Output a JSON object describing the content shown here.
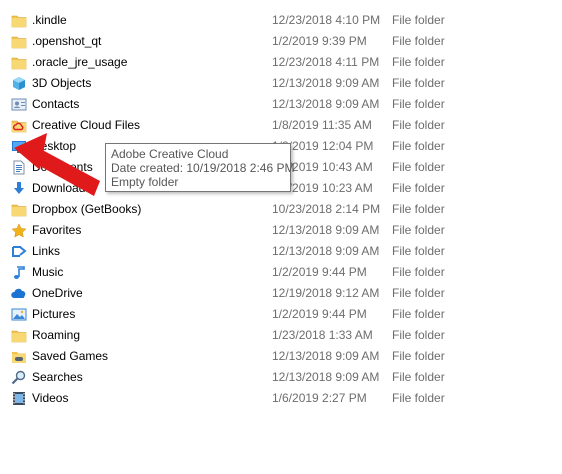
{
  "files": [
    {
      "name": ".kindle",
      "date": "12/23/2018 4:10 PM",
      "type": "File folder",
      "icon": "folder-icon"
    },
    {
      "name": ".openshot_qt",
      "date": "1/2/2019 9:39 PM",
      "type": "File folder",
      "icon": "folder-icon"
    },
    {
      "name": ".oracle_jre_usage",
      "date": "12/23/2018 4:11 PM",
      "type": "File folder",
      "icon": "folder-icon"
    },
    {
      "name": "3D Objects",
      "date": "12/13/2018 9:09 AM",
      "type": "File folder",
      "icon": "3d-objects-icon"
    },
    {
      "name": "Contacts",
      "date": "12/13/2018 9:09 AM",
      "type": "File folder",
      "icon": "contacts-icon"
    },
    {
      "name": "Creative Cloud Files",
      "date": "1/8/2019 11:35 AM",
      "type": "File folder",
      "icon": "creative-cloud-folder-icon"
    },
    {
      "name": "Desktop",
      "date": "1/8/2019 12:04 PM",
      "type": "File folder",
      "icon": "desktop-icon"
    },
    {
      "name": "Documents",
      "date": "1/2/2019 10:43 AM",
      "type": "File folder",
      "icon": "documents-icon"
    },
    {
      "name": "Downloads",
      "date": "1/2/2019 10:23 AM",
      "type": "File folder",
      "icon": "downloads-icon"
    },
    {
      "name": "Dropbox (GetBooks)",
      "date": "10/23/2018 2:14 PM",
      "type": "File folder",
      "icon": "folder-icon"
    },
    {
      "name": "Favorites",
      "date": "12/13/2018 9:09 AM",
      "type": "File folder",
      "icon": "favorites-icon"
    },
    {
      "name": "Links",
      "date": "12/13/2018 9:09 AM",
      "type": "File folder",
      "icon": "links-icon"
    },
    {
      "name": "Music",
      "date": "1/2/2019 9:44 PM",
      "type": "File folder",
      "icon": "music-icon"
    },
    {
      "name": "OneDrive",
      "date": "12/19/2018 9:12 AM",
      "type": "File folder",
      "icon": "onedrive-icon"
    },
    {
      "name": "Pictures",
      "date": "1/2/2019 9:44 PM",
      "type": "File folder",
      "icon": "pictures-icon"
    },
    {
      "name": "Roaming",
      "date": "1/23/2018 1:33 AM",
      "type": "File folder",
      "icon": "folder-icon"
    },
    {
      "name": "Saved Games",
      "date": "12/13/2018 9:09 AM",
      "type": "File folder",
      "icon": "saved-games-icon"
    },
    {
      "name": "Searches",
      "date": "12/13/2018 9:09 AM",
      "type": "File folder",
      "icon": "searches-icon"
    },
    {
      "name": "Videos",
      "date": "1/6/2019 2:27 PM",
      "type": "File folder",
      "icon": "videos-icon"
    }
  ],
  "tooltip": {
    "title": "Adobe Creative Cloud",
    "date_created": "Date created: 10/19/2018 2:46 PM",
    "status": "Empty folder"
  },
  "colors": {
    "folder": "#f4c24e",
    "arrow": "#e0191b",
    "secondary_text": "#6d6d6d"
  }
}
